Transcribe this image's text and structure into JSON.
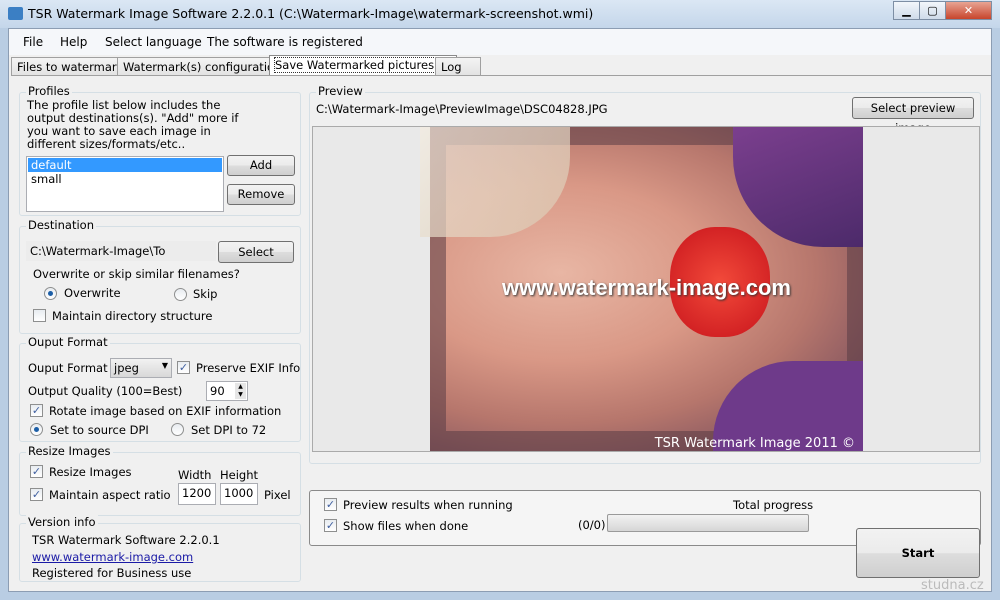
{
  "window": {
    "title": "TSR Watermark Image Software 2.2.0.1 (C:\\Watermark-Image\\watermark-screenshot.wmi)",
    "minimize": "▁",
    "maximize": "▢",
    "close": "✕"
  },
  "menu": {
    "file": "File",
    "help": "Help",
    "language": "Select language",
    "registered": "The software is registered"
  },
  "tabs": [
    "Files to watermark",
    "Watermark(s) configuration",
    "Save Watermarked pictures as",
    "Log"
  ],
  "profiles": {
    "title": "Profiles",
    "description": "The profile list below includes the output destinations(s). \"Add\" more if you want to save each image in different sizes/formats/etc..",
    "items": [
      "default",
      "small"
    ],
    "add": "Add",
    "remove": "Remove"
  },
  "destination": {
    "title": "Destination",
    "path": "C:\\Watermark-Image\\To",
    "select": "Select",
    "question": "Overwrite or skip similar filenames?",
    "overwrite": "Overwrite",
    "skip": "Skip",
    "maintain": "Maintain directory structure"
  },
  "format": {
    "title": "Ouput Format",
    "label": "Ouput Format",
    "value": "jpeg",
    "preserve_exif": "Preserve EXIF Info",
    "quality_label": "Output Quality (100=Best)",
    "quality": "90",
    "rotate": "Rotate image based on EXIF information",
    "source_dpi": "Set to source DPI",
    "dpi72": "Set DPI to 72"
  },
  "resize": {
    "title": "Resize Images",
    "resize": "Resize Images",
    "aspect": "Maintain aspect ratio",
    "width_label": "Width",
    "height_label": "Height",
    "width": "1200",
    "height": "1000",
    "unit": "Pixel"
  },
  "version": {
    "title": "Version info",
    "name": "TSR Watermark Software 2.2.0.1",
    "link": "www.watermark-image.com",
    "license": "Registered for Business use"
  },
  "preview": {
    "title": "Preview",
    "path": "C:\\Watermark-Image\\PreviewImage\\DSC04828.JPG",
    "select": "Select preview image",
    "watermark": "www.watermark-image.com",
    "copyright": "TSR Watermark Image 2011 ©"
  },
  "run": {
    "preview_results": "Preview results when running",
    "show_files": "Show files when done",
    "total_progress": "Total progress",
    "count": "(0/0)",
    "progress": 0,
    "start": "Start"
  },
  "corner_watermark": "studna.cz"
}
